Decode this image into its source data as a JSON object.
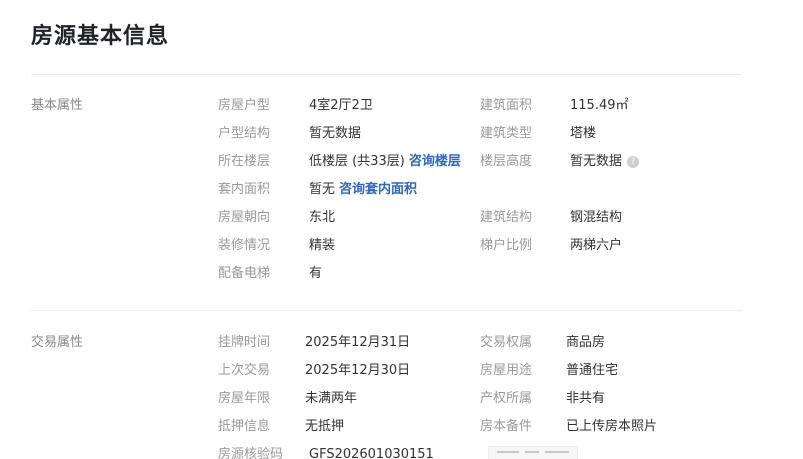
{
  "header": {
    "title": "房源基本信息"
  },
  "basic": {
    "section_label": "基本属性",
    "layout_label": "房屋户型",
    "layout_value": "4室2厅2卫",
    "area_label": "建筑面积",
    "area_value": "115.49㎡",
    "structure_label": "户型结构",
    "structure_value": "暂无数据",
    "building_type_label": "建筑类型",
    "building_type_value": "塔楼",
    "floor_label": "所在楼层",
    "floor_value": "低楼层 (共33层)",
    "floor_link": "咨询楼层",
    "floor_height_label": "楼层高度",
    "floor_height_value": "暂无数据",
    "help_glyph": "?",
    "inner_area_label": "套内面积",
    "inner_area_value": "暂无",
    "inner_area_link": "咨询套内面积",
    "orientation_label": "房屋朝向",
    "orientation_value": "东北",
    "construction_label": "建筑结构",
    "construction_value": "钢混结构",
    "decoration_label": "装修情况",
    "decoration_value": "精装",
    "elevator_ratio_label": "梯户比例",
    "elevator_ratio_value": "两梯六户",
    "elevator_label": "配备电梯",
    "elevator_value": "有"
  },
  "trade": {
    "section_label": "交易属性",
    "listing_time_label": "挂牌时间",
    "listing_time_value": "2025年12月31日",
    "ownership_label": "交易权属",
    "ownership_value": "商品房",
    "last_trade_label": "上次交易",
    "last_trade_value": "2025年12月30日",
    "usage_label": "房屋用途",
    "usage_value": "普通住宅",
    "years_label": "房屋年限",
    "years_value": "未满两年",
    "property_label": "产权所属",
    "property_value": "非共有",
    "mortgage_label": "抵押信息",
    "mortgage_value": "无抵押",
    "deed_label": "房本备件",
    "deed_value": "已上传房本照片",
    "verify_label": "房源核验码",
    "verify_value": "GFS202601030151"
  },
  "icons": {
    "help": "help-icon",
    "deed_thumbnail": "deed-photo-thumbnail"
  }
}
